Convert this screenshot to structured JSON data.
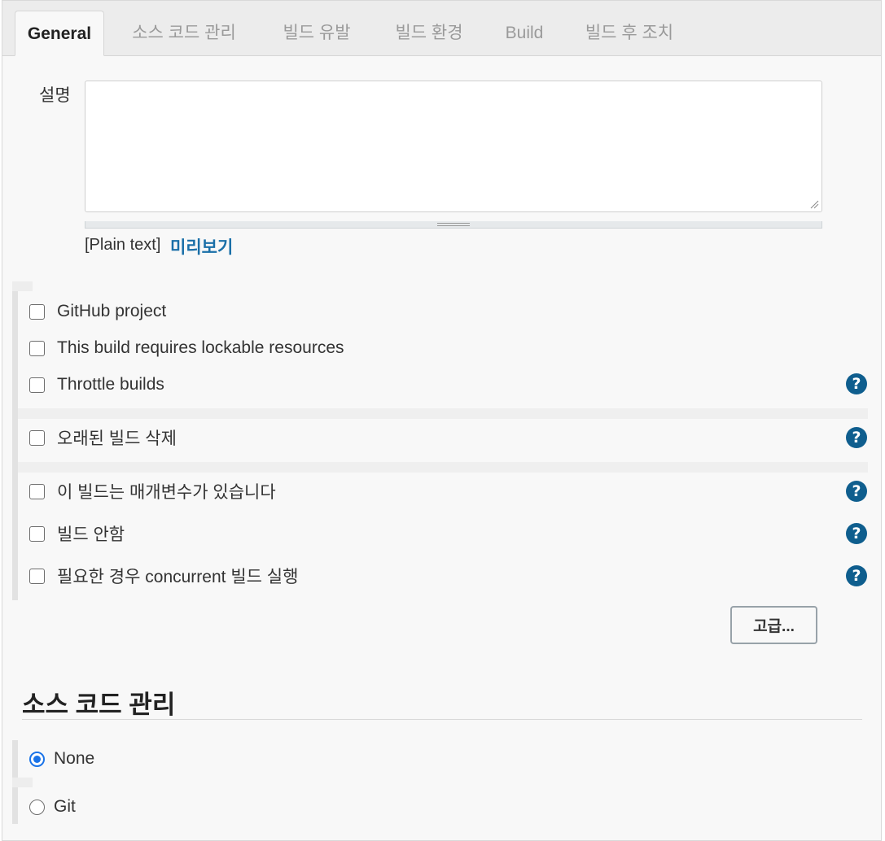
{
  "tabs": [
    {
      "label": "General"
    },
    {
      "label": "소스 코드 관리"
    },
    {
      "label": "빌드 유발"
    },
    {
      "label": "빌드 환경"
    },
    {
      "label": "Build"
    },
    {
      "label": "빌드 후 조치"
    }
  ],
  "description": {
    "label": "설명",
    "value": "",
    "format_label": "[Plain text]",
    "preview_label": "미리보기"
  },
  "options": [
    {
      "label": "GitHub project"
    },
    {
      "label": "This build requires lockable resources"
    },
    {
      "label": "Throttle builds"
    },
    {
      "label": "오래된 빌드 삭제"
    },
    {
      "label": "이 빌드는 매개변수가 있습니다"
    },
    {
      "label": "빌드 안함"
    },
    {
      "label": "필요한 경우 concurrent 빌드 실행"
    }
  ],
  "help_icon": "?",
  "advanced_button": "고급...",
  "scm": {
    "title": "소스 코드 관리",
    "choices": [
      {
        "label": "None",
        "selected": true
      },
      {
        "label": "Git",
        "selected": false
      }
    ]
  },
  "colors": {
    "link": "#1a6fa8",
    "help": "#0f5e8e",
    "radio": "#1a73e8"
  }
}
